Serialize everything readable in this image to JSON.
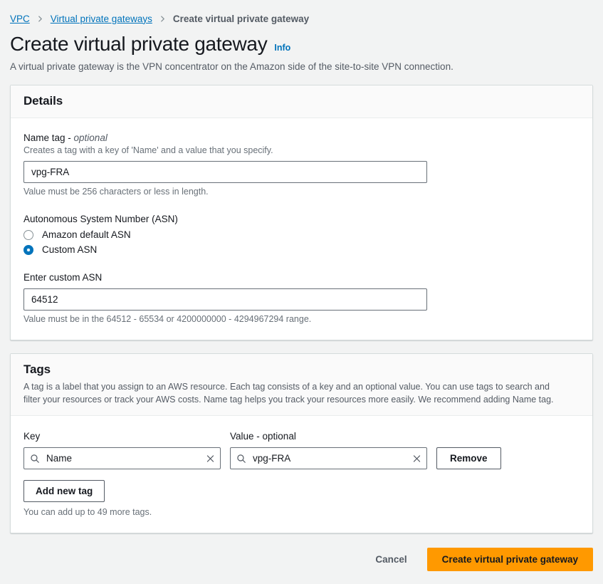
{
  "breadcrumb": {
    "items": [
      {
        "label": "VPC",
        "type": "link"
      },
      {
        "label": "Virtual private gateways",
        "type": "link"
      },
      {
        "label": "Create virtual private gateway",
        "type": "current"
      }
    ],
    "separator_icon": "chevron-right-icon"
  },
  "header": {
    "title": "Create virtual private gateway",
    "info_label": "Info",
    "description": "A virtual private gateway is the VPN concentrator on the Amazon side of the site-to-site VPN connection."
  },
  "details": {
    "title": "Details",
    "name_tag": {
      "label": "Name tag - ",
      "optional": "optional",
      "hint": "Creates a tag with a key of 'Name' and a value that you specify.",
      "value": "vpg-FRA",
      "placeholder": "",
      "constraint": "Value must be 256 characters or less in length."
    },
    "asn": {
      "group_label": "Autonomous System Number (ASN)",
      "options": [
        {
          "label": "Amazon default ASN",
          "selected": false
        },
        {
          "label": "Custom ASN",
          "selected": true
        }
      ],
      "custom_label": "Enter custom ASN",
      "custom_value": "64512",
      "custom_placeholder": "",
      "constraint": "Value must be in the 64512 - 65534 or 4200000000 - 4294967294 range."
    }
  },
  "tags": {
    "title": "Tags",
    "description": "A tag is a label that you assign to an AWS resource. Each tag consists of a key and an optional value. You can use tags to search and filter your resources or track your AWS costs. Name tag helps you track your resources more easily. We recommend adding Name tag.",
    "columns": {
      "key": "Key",
      "value": "Value - ",
      "value_optional": "optional"
    },
    "rows": [
      {
        "key": "Name",
        "key_placeholder": "",
        "value": "vpg-FRA",
        "value_placeholder": "",
        "remove_label": "Remove"
      }
    ],
    "add_label": "Add new tag",
    "footnote": "You can add up to 49 more tags.",
    "search_icon": "search-icon",
    "clear_icon": "close-icon"
  },
  "actions": {
    "cancel_label": "Cancel",
    "submit_label": "Create virtual private gateway"
  },
  "colors": {
    "accent_orange": "#ff9900",
    "link_blue": "#0073bb",
    "page_background": "#f2f3f3",
    "panel_background": "#ffffff",
    "border": "#d5dbdb"
  }
}
